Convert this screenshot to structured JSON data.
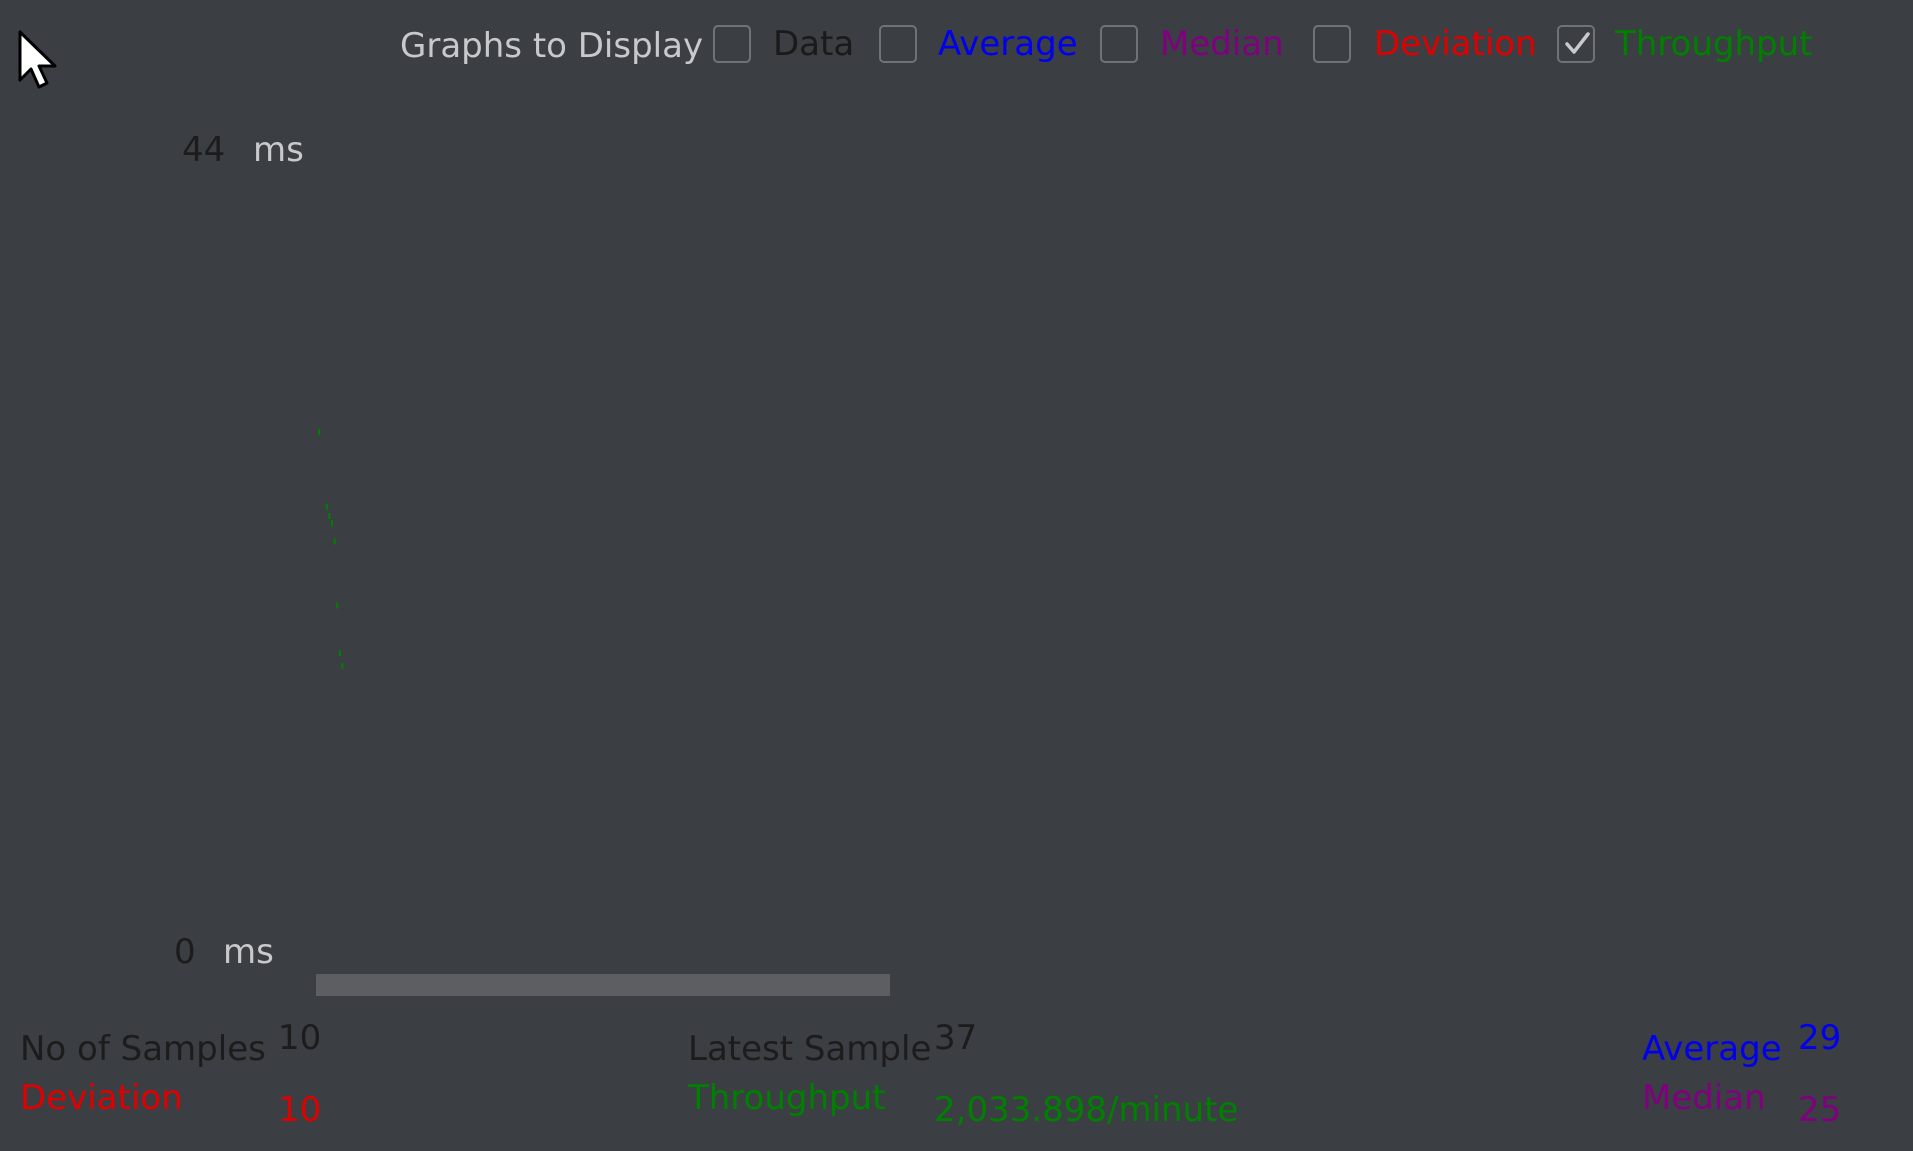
{
  "toolbar": {
    "title": "Graphs to Display",
    "options": [
      {
        "label": "Data",
        "checked": false,
        "color": "#1a1a1a"
      },
      {
        "label": "Average",
        "checked": false,
        "color": "#0000ee"
      },
      {
        "label": "Median",
        "checked": false,
        "color": "#800080"
      },
      {
        "label": "Deviation",
        "checked": false,
        "color": "#e00000"
      },
      {
        "label": "Throughput",
        "checked": true,
        "color": "#008000"
      }
    ]
  },
  "chart_data": {
    "type": "scatter",
    "series": [
      {
        "name": "Throughput",
        "color": "#008000",
        "x": [
          0,
          3,
          4,
          5,
          6,
          7,
          8,
          9
        ],
        "y": [
          28.6,
          24.5,
          24.0,
          23.6,
          22.6,
          19.1,
          16.5,
          15.8
        ]
      }
    ],
    "ylim": [
      0,
      44
    ],
    "ytick_top": "44",
    "ytick_bottom": "0",
    "yunit": "ms"
  },
  "stats": {
    "samples_label": "No of Samples",
    "samples_value": "10",
    "deviation_label": "Deviation",
    "deviation_value": "10",
    "latest_label": "Latest Sample",
    "latest_value": "37",
    "throughput_label": "Throughput",
    "throughput_value": "2,033.898/minute",
    "average_label": "Average",
    "average_value": "29",
    "median_label": "Median",
    "median_value": "25"
  },
  "colors": {
    "background": "#3b3e42",
    "label_gray": "#c7c9cc",
    "label_dark": "#1c1c1c",
    "average": "#0000ee",
    "median": "#800080",
    "deviation": "#e00000",
    "throughput": "#008000"
  }
}
